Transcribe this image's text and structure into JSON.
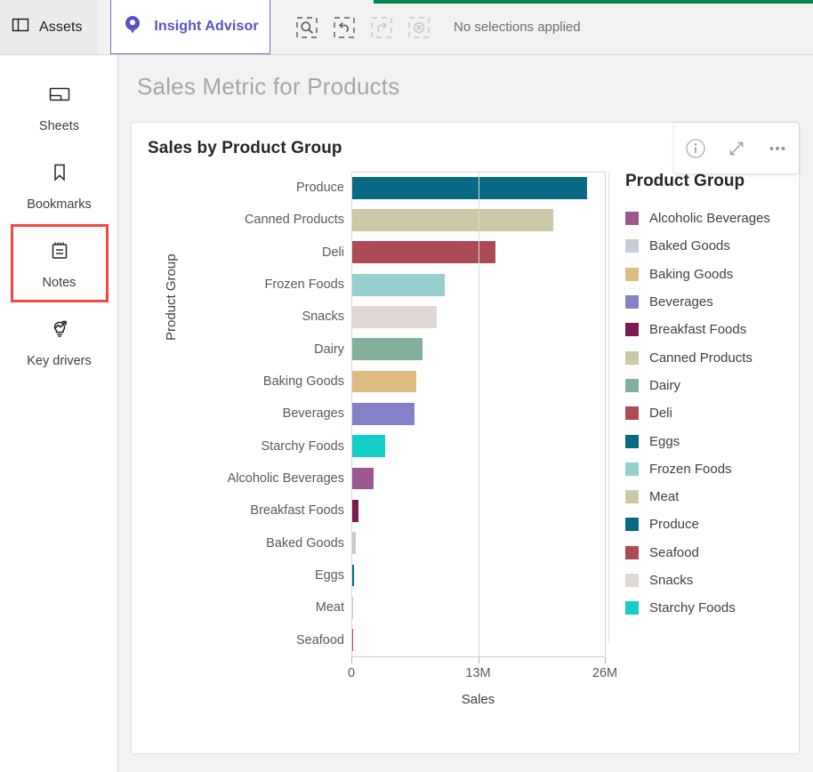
{
  "topbar": {
    "assets_label": "Assets",
    "advisor_tab_label": "Insight Advisor",
    "tools": [
      {
        "name": "smart-search-icon",
        "label": "Smart search",
        "disabled": false
      },
      {
        "name": "step-back-icon",
        "label": "Step back",
        "disabled": false
      },
      {
        "name": "step-forward-icon",
        "label": "Step forward",
        "disabled": true
      },
      {
        "name": "clear-selections-icon",
        "label": "Clear all selections",
        "disabled": true
      }
    ],
    "selection_status": "No selections applied",
    "progress_color": "#00874a"
  },
  "sidebar": {
    "items": [
      {
        "label": "Sheets",
        "icon": "sheets-icon",
        "highlighted": false
      },
      {
        "label": "Bookmarks",
        "icon": "bookmark-icon",
        "highlighted": false
      },
      {
        "label": "Notes",
        "icon": "notes-icon",
        "highlighted": true
      },
      {
        "label": "Key drivers",
        "icon": "key-drivers-icon",
        "highlighted": false
      }
    ],
    "highlight_color": "#f4483f"
  },
  "main": {
    "page_title": "Sales Metric for Products",
    "card_title": "Sales by Product Group",
    "card_actions": [
      {
        "name": "info-icon",
        "label": "Info"
      },
      {
        "name": "expand-icon",
        "label": "Full screen"
      },
      {
        "name": "more-options-icon",
        "label": "More options"
      }
    ]
  },
  "chart_data": {
    "type": "bar",
    "orientation": "horizontal",
    "title": "Sales by Product Group",
    "xlabel": "Sales",
    "ylabel": "Product Group",
    "xlim": [
      0,
      26000000
    ],
    "xticks": [
      0,
      13000000,
      26000000
    ],
    "xtick_labels": [
      "0",
      "13M",
      "26M"
    ],
    "grid": true,
    "legend_title": "Product Group",
    "legend_position": "right",
    "categories": [
      "Produce",
      "Canned Products",
      "Deli",
      "Frozen Foods",
      "Snacks",
      "Dairy",
      "Baking Goods",
      "Beverages",
      "Starchy Foods",
      "Alcoholic Beverages",
      "Breakfast Foods",
      "Baked Goods",
      "Eggs",
      "Meat",
      "Seafood"
    ],
    "values": [
      24200000,
      20700000,
      14800000,
      9600000,
      8800000,
      7300000,
      6700000,
      6500000,
      3500000,
      2300000,
      740000,
      460000,
      280000,
      60000,
      40000
    ],
    "colors": [
      "#0a6a85",
      "#ccc9a6",
      "#ac4a56",
      "#97cfcf",
      "#e0d8d4",
      "#82b09a",
      "#e0bc80",
      "#8481c9",
      "#13cdc8",
      "#9c5890",
      "#7c1a52",
      "#c3cdd6",
      "#0a6a85",
      "#ccc9a6",
      "#ac4a56"
    ],
    "legend_entries": [
      {
        "label": "Alcoholic Beverages",
        "color": "#9c5890"
      },
      {
        "label": "Baked Goods",
        "color": "#c3cdd6"
      },
      {
        "label": "Baking Goods",
        "color": "#e0bc80"
      },
      {
        "label": "Beverages",
        "color": "#8481c9"
      },
      {
        "label": "Breakfast Foods",
        "color": "#7c1a52"
      },
      {
        "label": "Canned Products",
        "color": "#ccc9a6"
      },
      {
        "label": "Dairy",
        "color": "#82b09a"
      },
      {
        "label": "Deli",
        "color": "#ac4a56"
      },
      {
        "label": "Eggs",
        "color": "#0a6a85"
      },
      {
        "label": "Frozen Foods",
        "color": "#97cfcf"
      },
      {
        "label": "Meat",
        "color": "#ccc9a6"
      },
      {
        "label": "Produce",
        "color": "#0a6a85"
      },
      {
        "label": "Seafood",
        "color": "#ac4a56"
      },
      {
        "label": "Snacks",
        "color": "#e0d8d4"
      },
      {
        "label": "Starchy Foods",
        "color": "#13cdc8"
      }
    ]
  }
}
